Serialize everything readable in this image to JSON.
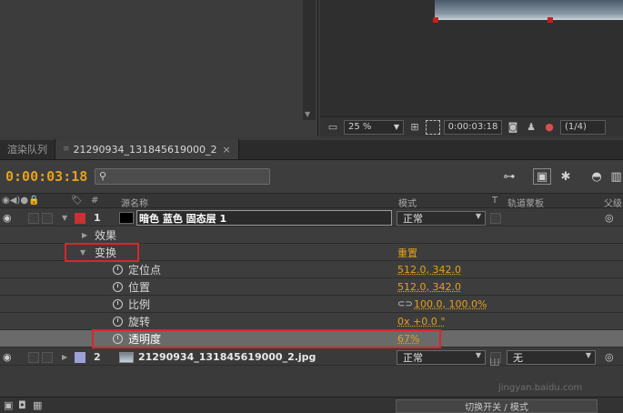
{
  "viewer": {
    "zoom": "25 %",
    "timecode": "0:00:03:18",
    "resolution": "(1/4)"
  },
  "tabs": [
    {
      "label": "渲染队列",
      "active": false
    },
    {
      "label": "21290934_131845619000_2",
      "active": true,
      "close": "×"
    }
  ],
  "timeline": {
    "current_time": "0:00:03:18"
  },
  "columns": {
    "number": "#",
    "source_name": "源名称",
    "mode": "模式",
    "t": "T",
    "track_matte": "轨道蒙板",
    "parent": "父级"
  },
  "layer1": {
    "index": "1",
    "name": "暗色 蓝色 固态层 1",
    "mode": "正常",
    "label_color": "#c83232"
  },
  "effects_label": "效果",
  "transform": {
    "label": "变换",
    "reset": "重置",
    "properties": [
      {
        "name": "定位点",
        "value": "512.0, 342.0"
      },
      {
        "name": "位置",
        "value": "512.0, 342.0"
      },
      {
        "name": "比例",
        "value": "100.0, 100.0%"
      },
      {
        "name": "旋转",
        "value": "0x +0.0 °"
      },
      {
        "name": "透明度",
        "value": "67%"
      }
    ]
  },
  "layer2": {
    "index": "2",
    "name": "21290934_131845619000_2.jpg",
    "mode": "正常",
    "track_matte_partial": "无",
    "label_color": "#a0a0d8"
  },
  "bottom": {
    "toggle_label": "切换开关 / 模式"
  },
  "watermark": {
    "line1": "Ш",
    "line2": "jingyan.baidu.com"
  },
  "colors": {
    "accent": "#e5a11a",
    "highlight": "#d9262c"
  }
}
